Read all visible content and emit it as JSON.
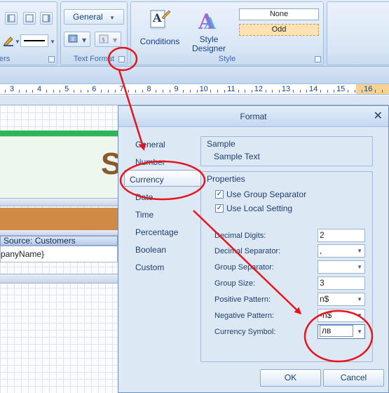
{
  "ribbon": {
    "left_group_label": "ers",
    "text_format": {
      "dropdown_value": "General",
      "label": "Text Format"
    },
    "style": {
      "conditions_label": "Conditions",
      "style_designer_label_line1": "Style",
      "style_designer_label_line2": "Designer",
      "style_none": "None",
      "style_odd": "Odd",
      "label": "Style"
    }
  },
  "ruler": {
    "numbers": [
      "3",
      "4",
      "5",
      "6",
      "7",
      "8",
      "9",
      "10",
      "11",
      "12",
      "13",
      "14",
      "15",
      "16"
    ]
  },
  "design": {
    "big_letter": "S",
    "datasource_label": "Source: Customers",
    "field_label": "panyName}"
  },
  "dialog": {
    "title": "Format",
    "close_glyph": "✕",
    "nav_items": [
      "General",
      "Number",
      "Currency",
      "Date",
      "Time",
      "Percentage",
      "Boolean",
      "Custom"
    ],
    "selected_nav": "Currency",
    "sample": {
      "title": "Sample",
      "text": "Sample Text"
    },
    "properties": {
      "title": "Properties",
      "use_group_separator_label": "Use Group Separator",
      "use_local_setting_label": "Use Local Setting",
      "decimal_digits_label": "Decimal Digits:",
      "decimal_digits_value": "2",
      "decimal_separator_label": "Decimal Separator:",
      "decimal_separator_value": ",",
      "group_separator_label": "Group Separator:",
      "group_separator_value": "",
      "group_size_label": "Group Size:",
      "group_size_value": "3",
      "positive_pattern_label": "Positive Pattern:",
      "positive_pattern_value": "n$",
      "negative_pattern_label": "Negative Pattern:",
      "negative_pattern_value": "-n$",
      "currency_symbol_label": "Currency Symbol:",
      "currency_symbol_value": "лв"
    },
    "ok_label": "OK",
    "cancel_label": "Cancel"
  },
  "colors": {
    "annotation": "#e8141c",
    "ribbon_text": "#15428b",
    "band_orange": "#d08a45",
    "band_green": "#2fb55a"
  }
}
